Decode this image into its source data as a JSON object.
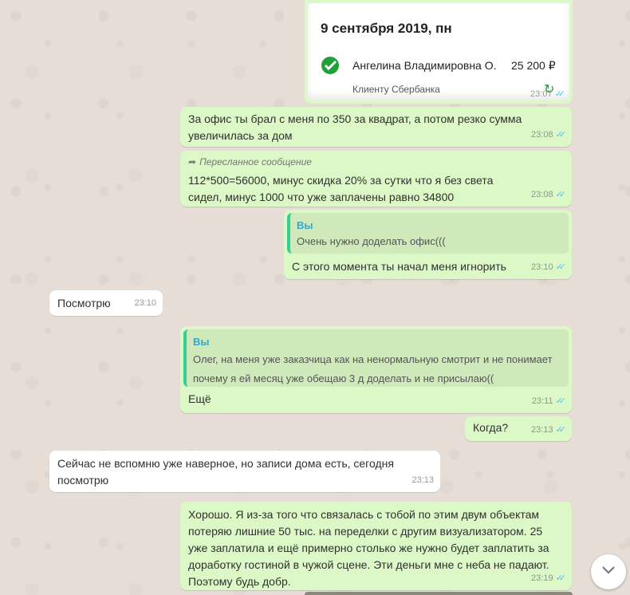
{
  "receipt": {
    "date": "9 сентября 2019, пн",
    "name": "Ангелина Владимировна О.",
    "amount": "25 200 ₽",
    "note": "Клиенту Сбербанка",
    "time": "23:07"
  },
  "messages": [
    {
      "text": "За офис ты брал с меня по 350 за квадрат, а потом резко сумма увеличилась за дом",
      "time": "23:08"
    },
    {
      "forwarded_label": "Пересланное сообщение",
      "text": "112*500=56000, минус скидка 20% за сутки что я без света сидел, минус 1000 что уже заплачены равно 34800",
      "time": "23:08"
    },
    {
      "quote_author": "Вы",
      "quote_text": "Очень нужно доделать офис(((",
      "text": "С этого момента ты начал меня игнорить",
      "time": "23:10"
    },
    {
      "text": "Посмотрю",
      "time": "23:10"
    },
    {
      "quote_author": "Вы",
      "quote_text": "Олег, на меня уже заказчица как на ненормальную смотрит и не понимает почему я ей месяц уже обещаю 3 д доделать и не присылаю((",
      "text": "Ещё",
      "time": "23:11"
    },
    {
      "text": "Когда?",
      "time": "23:13"
    },
    {
      "text": "Сейчас не вспомню уже наверное, но записи дома есть, сегодня посмотрю",
      "time": "23:13"
    },
    {
      "text": "Хорошо. Я из-за того что связалась с тобой по этим двум объектам потеряю лишние 50 тыс. на переделки с другим визуализатором. 25 уже заплатила и ещё примерно столько же нужно будет заплатить за доработку гостиной в чужой сцене. Эти деньги мне с неба не падают. Поэтому будь добр.",
      "time": "23:19"
    }
  ],
  "icons": {
    "ticks": "double-check-icon",
    "forward": "forward-arrow-icon",
    "scroll": "chevron-down-icon",
    "bank": "sberbank-logo-icon"
  },
  "colors": {
    "outgoing": "#dcf8c6",
    "incoming": "#ffffff",
    "read_ticks": "#4fc3f7",
    "quote_bar": "#35cd96",
    "bank_green": "#21a038"
  }
}
